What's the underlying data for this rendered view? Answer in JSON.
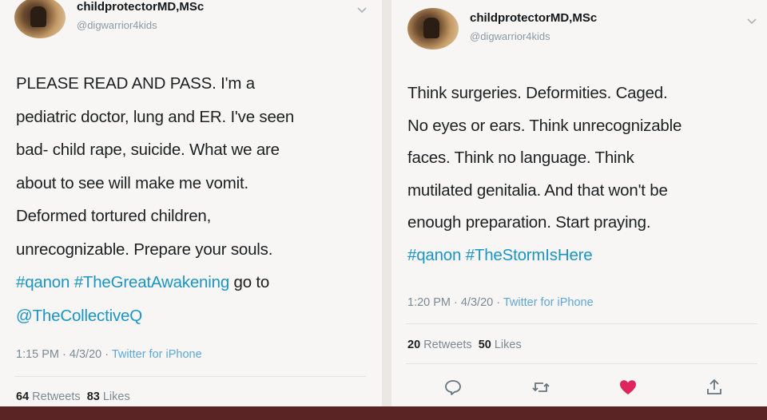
{
  "left": {
    "name": "childprotectorMD,MSc",
    "handle": "@digwarrior4kids",
    "text_lines": [
      "PLEASE READ AND PASS. I'm a",
      "pediatric doctor, lung and ER. I've seen",
      "bad- child rape, suicide. What we are",
      "about to see will make me vomit.",
      "Deformed tortured children,",
      "unrecognizable. Prepare your souls."
    ],
    "hashtags_line": "#qanon #TheGreatAwakening",
    "goto": " go to",
    "mention": "@TheCollectiveQ",
    "time": "1:15 PM · 4/3/20 · ",
    "source": "Twitter for iPhone",
    "retweets": "64",
    "retweets_label": "Retweets",
    "likes": "83",
    "likes_label": "Likes"
  },
  "right": {
    "name": "childprotectorMD,MSc",
    "handle": "@digwarrior4kids",
    "text_lines": [
      "Think surgeries. Deformities. Caged.",
      "No eyes or ears. Think unrecognizable",
      "faces. Think no language. Think",
      "mutilated genitalia. And that won't be",
      "enough preparation. Start praying."
    ],
    "hashtags_line": "#qanon #TheStormIsHere",
    "time": "1:20 PM · 4/3/20 · ",
    "source": "Twitter for iPhone",
    "retweets": "20",
    "retweets_label": "Retweets",
    "likes": "50",
    "likes_label": "Likes"
  },
  "icons": [
    "reply-icon",
    "retweet-icon",
    "heart-icon",
    "share-icon",
    "chevron-down-icon"
  ],
  "colors": {
    "link": "#1b95c6",
    "heart": "#e0245e",
    "bottom_bar": "#5a2424"
  }
}
